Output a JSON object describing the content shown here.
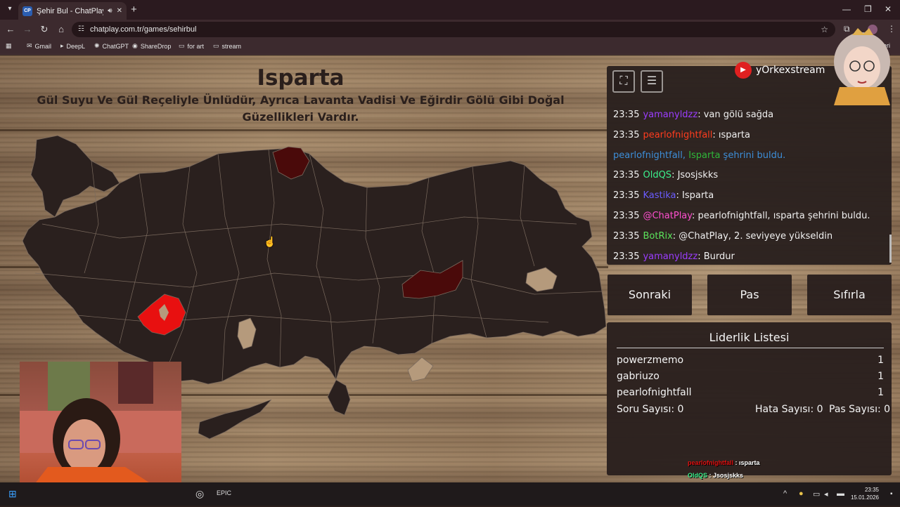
{
  "browser": {
    "tab_title": "Şehir Bul - ChatPlay",
    "tab_favicon": "CP",
    "url": "chatplay.com.tr/games/sehirbul",
    "bookmarks": [
      "Gmail",
      "DeepL",
      "ChatGPT",
      "ShareDrop",
      "for art",
      "stream"
    ],
    "bookmarks_more": "etleri"
  },
  "game": {
    "city": "Isparta",
    "description": "Gül Suyu Ve Gül Reçeliyle Ünlüdür, Ayrıca Lavanta Vadisi Ve Eğirdir Gölü Gibi Doğal Güzellikleri Vardır.",
    "highlight_color": "#e81010",
    "guessed_color": "#4a0a0a",
    "map_fill": "#2a201e"
  },
  "chat": {
    "channel": "yOrkexstream",
    "messages": [
      {
        "time": "23:35",
        "user": "yamanyldzz",
        "color": "#9b3dff",
        "text": ": van gölü sağda"
      },
      {
        "time": "23:35",
        "user": "pearlofnightfall",
        "color": "#ff3c1e",
        "text": ": ısparta"
      },
      {
        "system": true,
        "user": "pearlofnightfall",
        "city": "Isparta",
        "text": "şehrini buldu."
      },
      {
        "time": "23:35",
        "user": "OldQS",
        "color": "#3cf08c",
        "text": ": Jsosjskks"
      },
      {
        "time": "23:35",
        "user": "Kastika",
        "color": "#6b5cff",
        "text": ": Isparta"
      },
      {
        "time": "23:35",
        "user": "@ChatPlay",
        "color": "#ff4fd0",
        "text": ": pearlofnightfall, ısparta şehrini buldu."
      },
      {
        "time": "23:35",
        "user": "BotRix",
        "color": "#5be35b",
        "text": ": @ChatPlay, 2. seviyeye yükseldin"
      },
      {
        "time": "23:35",
        "user": "yamanyldzz",
        "color": "#9b3dff",
        "text": ": Burdur"
      }
    ]
  },
  "buttons": {
    "next": "Sonraki",
    "pass": "Pas",
    "reset": "Sıfırla"
  },
  "leaderboard": {
    "title": "Liderlik Listesi",
    "rows": [
      {
        "name": "powerzmemo",
        "score": "1"
      },
      {
        "name": "gabriuzo",
        "score": "1"
      },
      {
        "name": "pearlofnightfall",
        "score": "1"
      }
    ],
    "question_count": "Soru Sayısı: 0",
    "error_count": "Hata Sayısı: 0",
    "pass_count": "Pas Sayısı: 0"
  },
  "overlay_chat": [
    {
      "user": "pearlofnightfall",
      "color": "#e01010",
      "text": " : ısparta"
    },
    {
      "user": "OldQS",
      "color": "#3cf08c",
      "text": " : Jsosjskks"
    },
    {
      "user": "Kastika",
      "color": "#3cf08c",
      "text": " : Isparta"
    },
    {
      "user": "yamanyldzz",
      "color": "#9b6dff",
      "text": " : Burdur"
    }
  ],
  "taskbar": {
    "time": "23:35",
    "date": "15.01.2026"
  }
}
